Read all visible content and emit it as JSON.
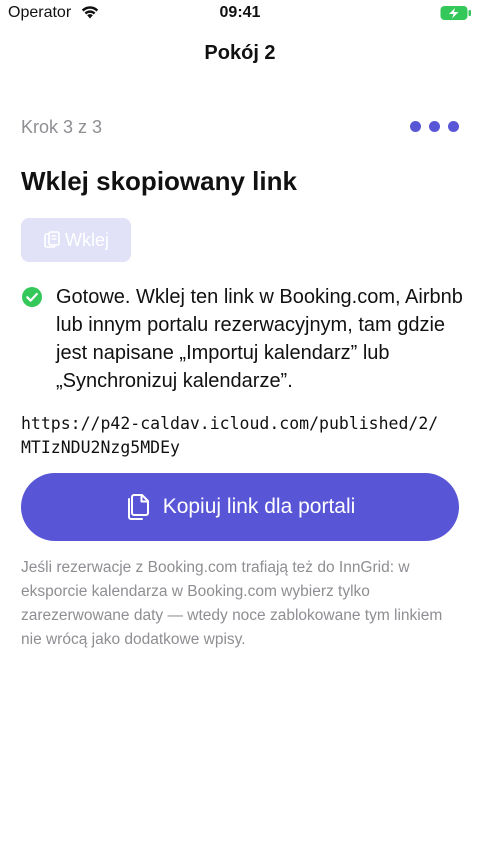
{
  "status_bar": {
    "carrier": "Operator",
    "time": "09:41",
    "battery_color": "#34c759"
  },
  "nav": {
    "title": "Pokój 2"
  },
  "step": {
    "label": "Krok 3 z 3",
    "dots_count": 3,
    "accent": "#5856d6"
  },
  "main": {
    "heading": "Wklej skopiowany link",
    "paste_button_label": "Wklej",
    "success_message": "Gotowe. Wklej ten link w Booking.com, Airbnb lub innym portalu rezerwacyjnym, tam gdzie jest napisane „Importuj kalendarz” lub „Synchronizuj kalendarze”.",
    "link_line1": "https://p42-caldav.icloud.com/published/2/",
    "link_line2": "MTIzNDU2Nzg5MDEy",
    "copy_button_label": "Kopiuj link dla portali",
    "note": "Jeśli rezerwacje z Booking.com trafiają też do InnGrid: w eksporcie kalendarza w Booking.com wybierz tylko zarezerwowane daty — wtedy noce zablokowane tym linkiem nie wrócą jako dodatkowe wpisy."
  },
  "colors": {
    "primary": "#5856d6",
    "primary_disabled": "#e1e1f7",
    "success": "#34c759",
    "secondary_text": "#8e8e93"
  }
}
